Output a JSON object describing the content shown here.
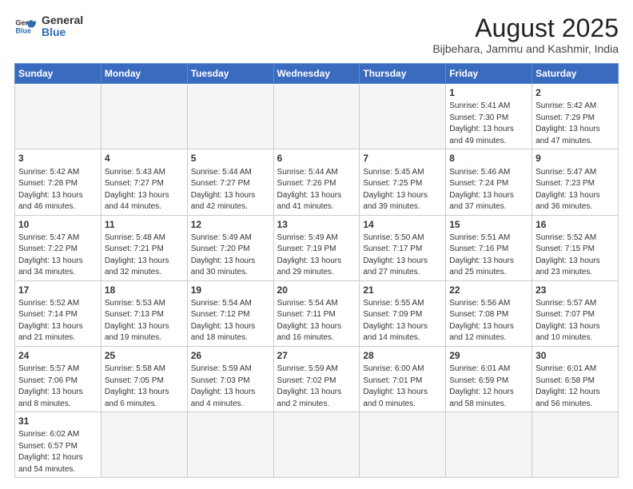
{
  "header": {
    "title": "August 2025",
    "subtitle": "Bijbehara, Jammu and Kashmir, India",
    "logo_general": "General",
    "logo_blue": "Blue"
  },
  "weekdays": [
    "Sunday",
    "Monday",
    "Tuesday",
    "Wednesday",
    "Thursday",
    "Friday",
    "Saturday"
  ],
  "weeks": [
    [
      {
        "day": "",
        "info": ""
      },
      {
        "day": "",
        "info": ""
      },
      {
        "day": "",
        "info": ""
      },
      {
        "day": "",
        "info": ""
      },
      {
        "day": "",
        "info": ""
      },
      {
        "day": "1",
        "info": "Sunrise: 5:41 AM\nSunset: 7:30 PM\nDaylight: 13 hours and 49 minutes."
      },
      {
        "day": "2",
        "info": "Sunrise: 5:42 AM\nSunset: 7:29 PM\nDaylight: 13 hours and 47 minutes."
      }
    ],
    [
      {
        "day": "3",
        "info": "Sunrise: 5:42 AM\nSunset: 7:28 PM\nDaylight: 13 hours and 46 minutes."
      },
      {
        "day": "4",
        "info": "Sunrise: 5:43 AM\nSunset: 7:27 PM\nDaylight: 13 hours and 44 minutes."
      },
      {
        "day": "5",
        "info": "Sunrise: 5:44 AM\nSunset: 7:27 PM\nDaylight: 13 hours and 42 minutes."
      },
      {
        "day": "6",
        "info": "Sunrise: 5:44 AM\nSunset: 7:26 PM\nDaylight: 13 hours and 41 minutes."
      },
      {
        "day": "7",
        "info": "Sunrise: 5:45 AM\nSunset: 7:25 PM\nDaylight: 13 hours and 39 minutes."
      },
      {
        "day": "8",
        "info": "Sunrise: 5:46 AM\nSunset: 7:24 PM\nDaylight: 13 hours and 37 minutes."
      },
      {
        "day": "9",
        "info": "Sunrise: 5:47 AM\nSunset: 7:23 PM\nDaylight: 13 hours and 36 minutes."
      }
    ],
    [
      {
        "day": "10",
        "info": "Sunrise: 5:47 AM\nSunset: 7:22 PM\nDaylight: 13 hours and 34 minutes."
      },
      {
        "day": "11",
        "info": "Sunrise: 5:48 AM\nSunset: 7:21 PM\nDaylight: 13 hours and 32 minutes."
      },
      {
        "day": "12",
        "info": "Sunrise: 5:49 AM\nSunset: 7:20 PM\nDaylight: 13 hours and 30 minutes."
      },
      {
        "day": "13",
        "info": "Sunrise: 5:49 AM\nSunset: 7:19 PM\nDaylight: 13 hours and 29 minutes."
      },
      {
        "day": "14",
        "info": "Sunrise: 5:50 AM\nSunset: 7:17 PM\nDaylight: 13 hours and 27 minutes."
      },
      {
        "day": "15",
        "info": "Sunrise: 5:51 AM\nSunset: 7:16 PM\nDaylight: 13 hours and 25 minutes."
      },
      {
        "day": "16",
        "info": "Sunrise: 5:52 AM\nSunset: 7:15 PM\nDaylight: 13 hours and 23 minutes."
      }
    ],
    [
      {
        "day": "17",
        "info": "Sunrise: 5:52 AM\nSunset: 7:14 PM\nDaylight: 13 hours and 21 minutes."
      },
      {
        "day": "18",
        "info": "Sunrise: 5:53 AM\nSunset: 7:13 PM\nDaylight: 13 hours and 19 minutes."
      },
      {
        "day": "19",
        "info": "Sunrise: 5:54 AM\nSunset: 7:12 PM\nDaylight: 13 hours and 18 minutes."
      },
      {
        "day": "20",
        "info": "Sunrise: 5:54 AM\nSunset: 7:11 PM\nDaylight: 13 hours and 16 minutes."
      },
      {
        "day": "21",
        "info": "Sunrise: 5:55 AM\nSunset: 7:09 PM\nDaylight: 13 hours and 14 minutes."
      },
      {
        "day": "22",
        "info": "Sunrise: 5:56 AM\nSunset: 7:08 PM\nDaylight: 13 hours and 12 minutes."
      },
      {
        "day": "23",
        "info": "Sunrise: 5:57 AM\nSunset: 7:07 PM\nDaylight: 13 hours and 10 minutes."
      }
    ],
    [
      {
        "day": "24",
        "info": "Sunrise: 5:57 AM\nSunset: 7:06 PM\nDaylight: 13 hours and 8 minutes."
      },
      {
        "day": "25",
        "info": "Sunrise: 5:58 AM\nSunset: 7:05 PM\nDaylight: 13 hours and 6 minutes."
      },
      {
        "day": "26",
        "info": "Sunrise: 5:59 AM\nSunset: 7:03 PM\nDaylight: 13 hours and 4 minutes."
      },
      {
        "day": "27",
        "info": "Sunrise: 5:59 AM\nSunset: 7:02 PM\nDaylight: 13 hours and 2 minutes."
      },
      {
        "day": "28",
        "info": "Sunrise: 6:00 AM\nSunset: 7:01 PM\nDaylight: 13 hours and 0 minutes."
      },
      {
        "day": "29",
        "info": "Sunrise: 6:01 AM\nSunset: 6:59 PM\nDaylight: 12 hours and 58 minutes."
      },
      {
        "day": "30",
        "info": "Sunrise: 6:01 AM\nSunset: 6:58 PM\nDaylight: 12 hours and 56 minutes."
      }
    ],
    [
      {
        "day": "31",
        "info": "Sunrise: 6:02 AM\nSunset: 6:57 PM\nDaylight: 12 hours and 54 minutes."
      },
      {
        "day": "",
        "info": ""
      },
      {
        "day": "",
        "info": ""
      },
      {
        "day": "",
        "info": ""
      },
      {
        "day": "",
        "info": ""
      },
      {
        "day": "",
        "info": ""
      },
      {
        "day": "",
        "info": ""
      }
    ]
  ]
}
